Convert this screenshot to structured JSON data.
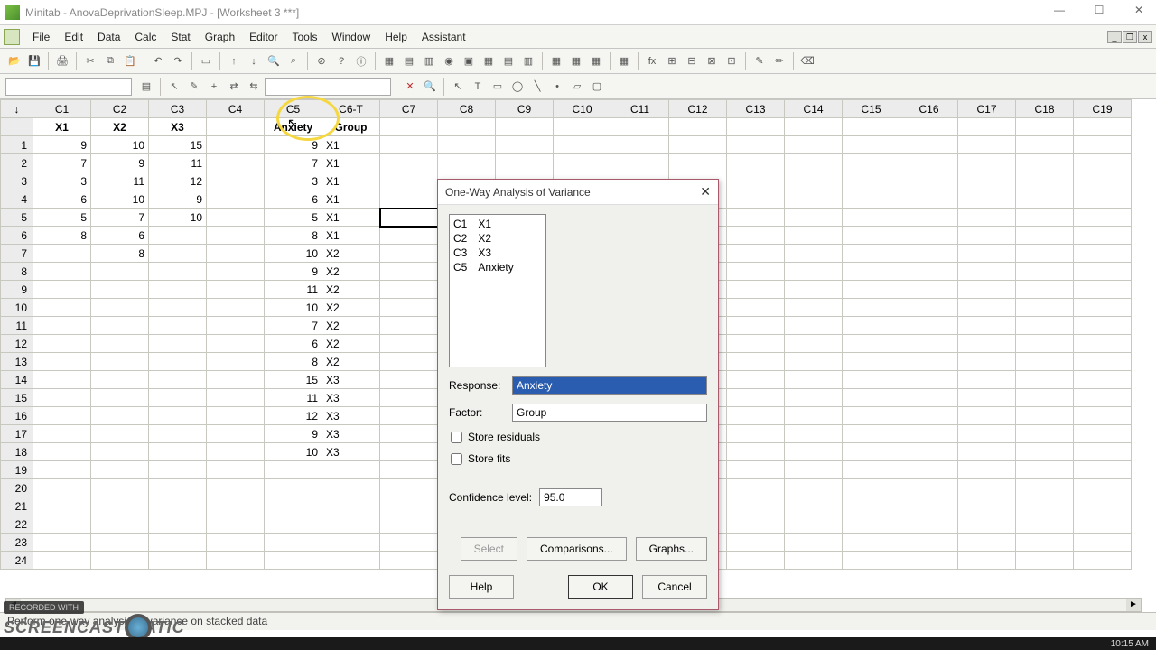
{
  "window": {
    "title": "Minitab - AnovaDeprivationSleep.MPJ - [Worksheet 3 ***]"
  },
  "menu": {
    "items": [
      "File",
      "Edit",
      "Data",
      "Calc",
      "Stat",
      "Graph",
      "Editor",
      "Tools",
      "Window",
      "Help",
      "Assistant"
    ]
  },
  "columns": {
    "headers": [
      "C1",
      "C2",
      "C3",
      "C4",
      "C5",
      "C6-T",
      "C7",
      "C8",
      "C9",
      "C10",
      "C11",
      "C12",
      "C13",
      "C14",
      "C15",
      "C16",
      "C17",
      "C18",
      "C19"
    ],
    "names": [
      "X1",
      "X2",
      "X3",
      "",
      "Anxiety",
      "Group",
      "",
      "",
      "",
      "",
      "",
      "",
      "",
      "",
      "",
      "",
      "",
      "",
      ""
    ]
  },
  "rows": [
    {
      "n": 1,
      "c": [
        "9",
        "10",
        "15",
        "",
        "9",
        "X1"
      ]
    },
    {
      "n": 2,
      "c": [
        "7",
        "9",
        "11",
        "",
        "7",
        "X1"
      ]
    },
    {
      "n": 3,
      "c": [
        "3",
        "11",
        "12",
        "",
        "3",
        "X1"
      ]
    },
    {
      "n": 4,
      "c": [
        "6",
        "10",
        "9",
        "",
        "6",
        "X1"
      ]
    },
    {
      "n": 5,
      "c": [
        "5",
        "7",
        "10",
        "",
        "5",
        "X1"
      ]
    },
    {
      "n": 6,
      "c": [
        "8",
        "6",
        "",
        "",
        "8",
        "X1"
      ]
    },
    {
      "n": 7,
      "c": [
        "",
        "8",
        "",
        "",
        "10",
        "X2"
      ]
    },
    {
      "n": 8,
      "c": [
        "",
        "",
        "",
        "",
        "9",
        "X2"
      ]
    },
    {
      "n": 9,
      "c": [
        "",
        "",
        "",
        "",
        "11",
        "X2"
      ]
    },
    {
      "n": 10,
      "c": [
        "",
        "",
        "",
        "",
        "10",
        "X2"
      ]
    },
    {
      "n": 11,
      "c": [
        "",
        "",
        "",
        "",
        "7",
        "X2"
      ]
    },
    {
      "n": 12,
      "c": [
        "",
        "",
        "",
        "",
        "6",
        "X2"
      ]
    },
    {
      "n": 13,
      "c": [
        "",
        "",
        "",
        "",
        "8",
        "X2"
      ]
    },
    {
      "n": 14,
      "c": [
        "",
        "",
        "",
        "",
        "15",
        "X3"
      ]
    },
    {
      "n": 15,
      "c": [
        "",
        "",
        "",
        "",
        "11",
        "X3"
      ]
    },
    {
      "n": 16,
      "c": [
        "",
        "",
        "",
        "",
        "12",
        "X3"
      ]
    },
    {
      "n": 17,
      "c": [
        "",
        "",
        "",
        "",
        "9",
        "X3"
      ]
    },
    {
      "n": 18,
      "c": [
        "",
        "",
        "",
        "",
        "10",
        "X3"
      ]
    },
    {
      "n": 19,
      "c": [
        "",
        "",
        "",
        "",
        "",
        ""
      ]
    },
    {
      "n": 20,
      "c": [
        "",
        "",
        "",
        "",
        "",
        ""
      ]
    },
    {
      "n": 21,
      "c": [
        "",
        "",
        "",
        "",
        "",
        ""
      ]
    },
    {
      "n": 22,
      "c": [
        "",
        "",
        "",
        "",
        "",
        ""
      ]
    },
    {
      "n": 23,
      "c": [
        "",
        "",
        "",
        "",
        "",
        ""
      ]
    },
    {
      "n": 24,
      "c": [
        "",
        "",
        "",
        "",
        "",
        ""
      ]
    }
  ],
  "dialog": {
    "title": "One-Way Analysis of Variance",
    "vars": [
      {
        "col": "C1",
        "name": "X1"
      },
      {
        "col": "C2",
        "name": "X2"
      },
      {
        "col": "C3",
        "name": "X3"
      },
      {
        "col": "C5",
        "name": "Anxiety"
      }
    ],
    "response_label": "Response:",
    "response_value": "Anxiety",
    "factor_label": "Factor:",
    "factor_value": "Group",
    "store_residuals": "Store residuals",
    "store_fits": "Store fits",
    "confidence_label": "Confidence level:",
    "confidence_value": "95.0",
    "select": "Select",
    "comparisons": "Comparisons...",
    "graphs": "Graphs...",
    "help": "Help",
    "ok": "OK",
    "cancel": "Cancel"
  },
  "status": "Perform one-way analysis of variance on stacked data",
  "watermark": {
    "rec": "RECORDED WITH",
    "logo": "SCREENCAST  MATIC"
  },
  "clock": "10:15 AM"
}
